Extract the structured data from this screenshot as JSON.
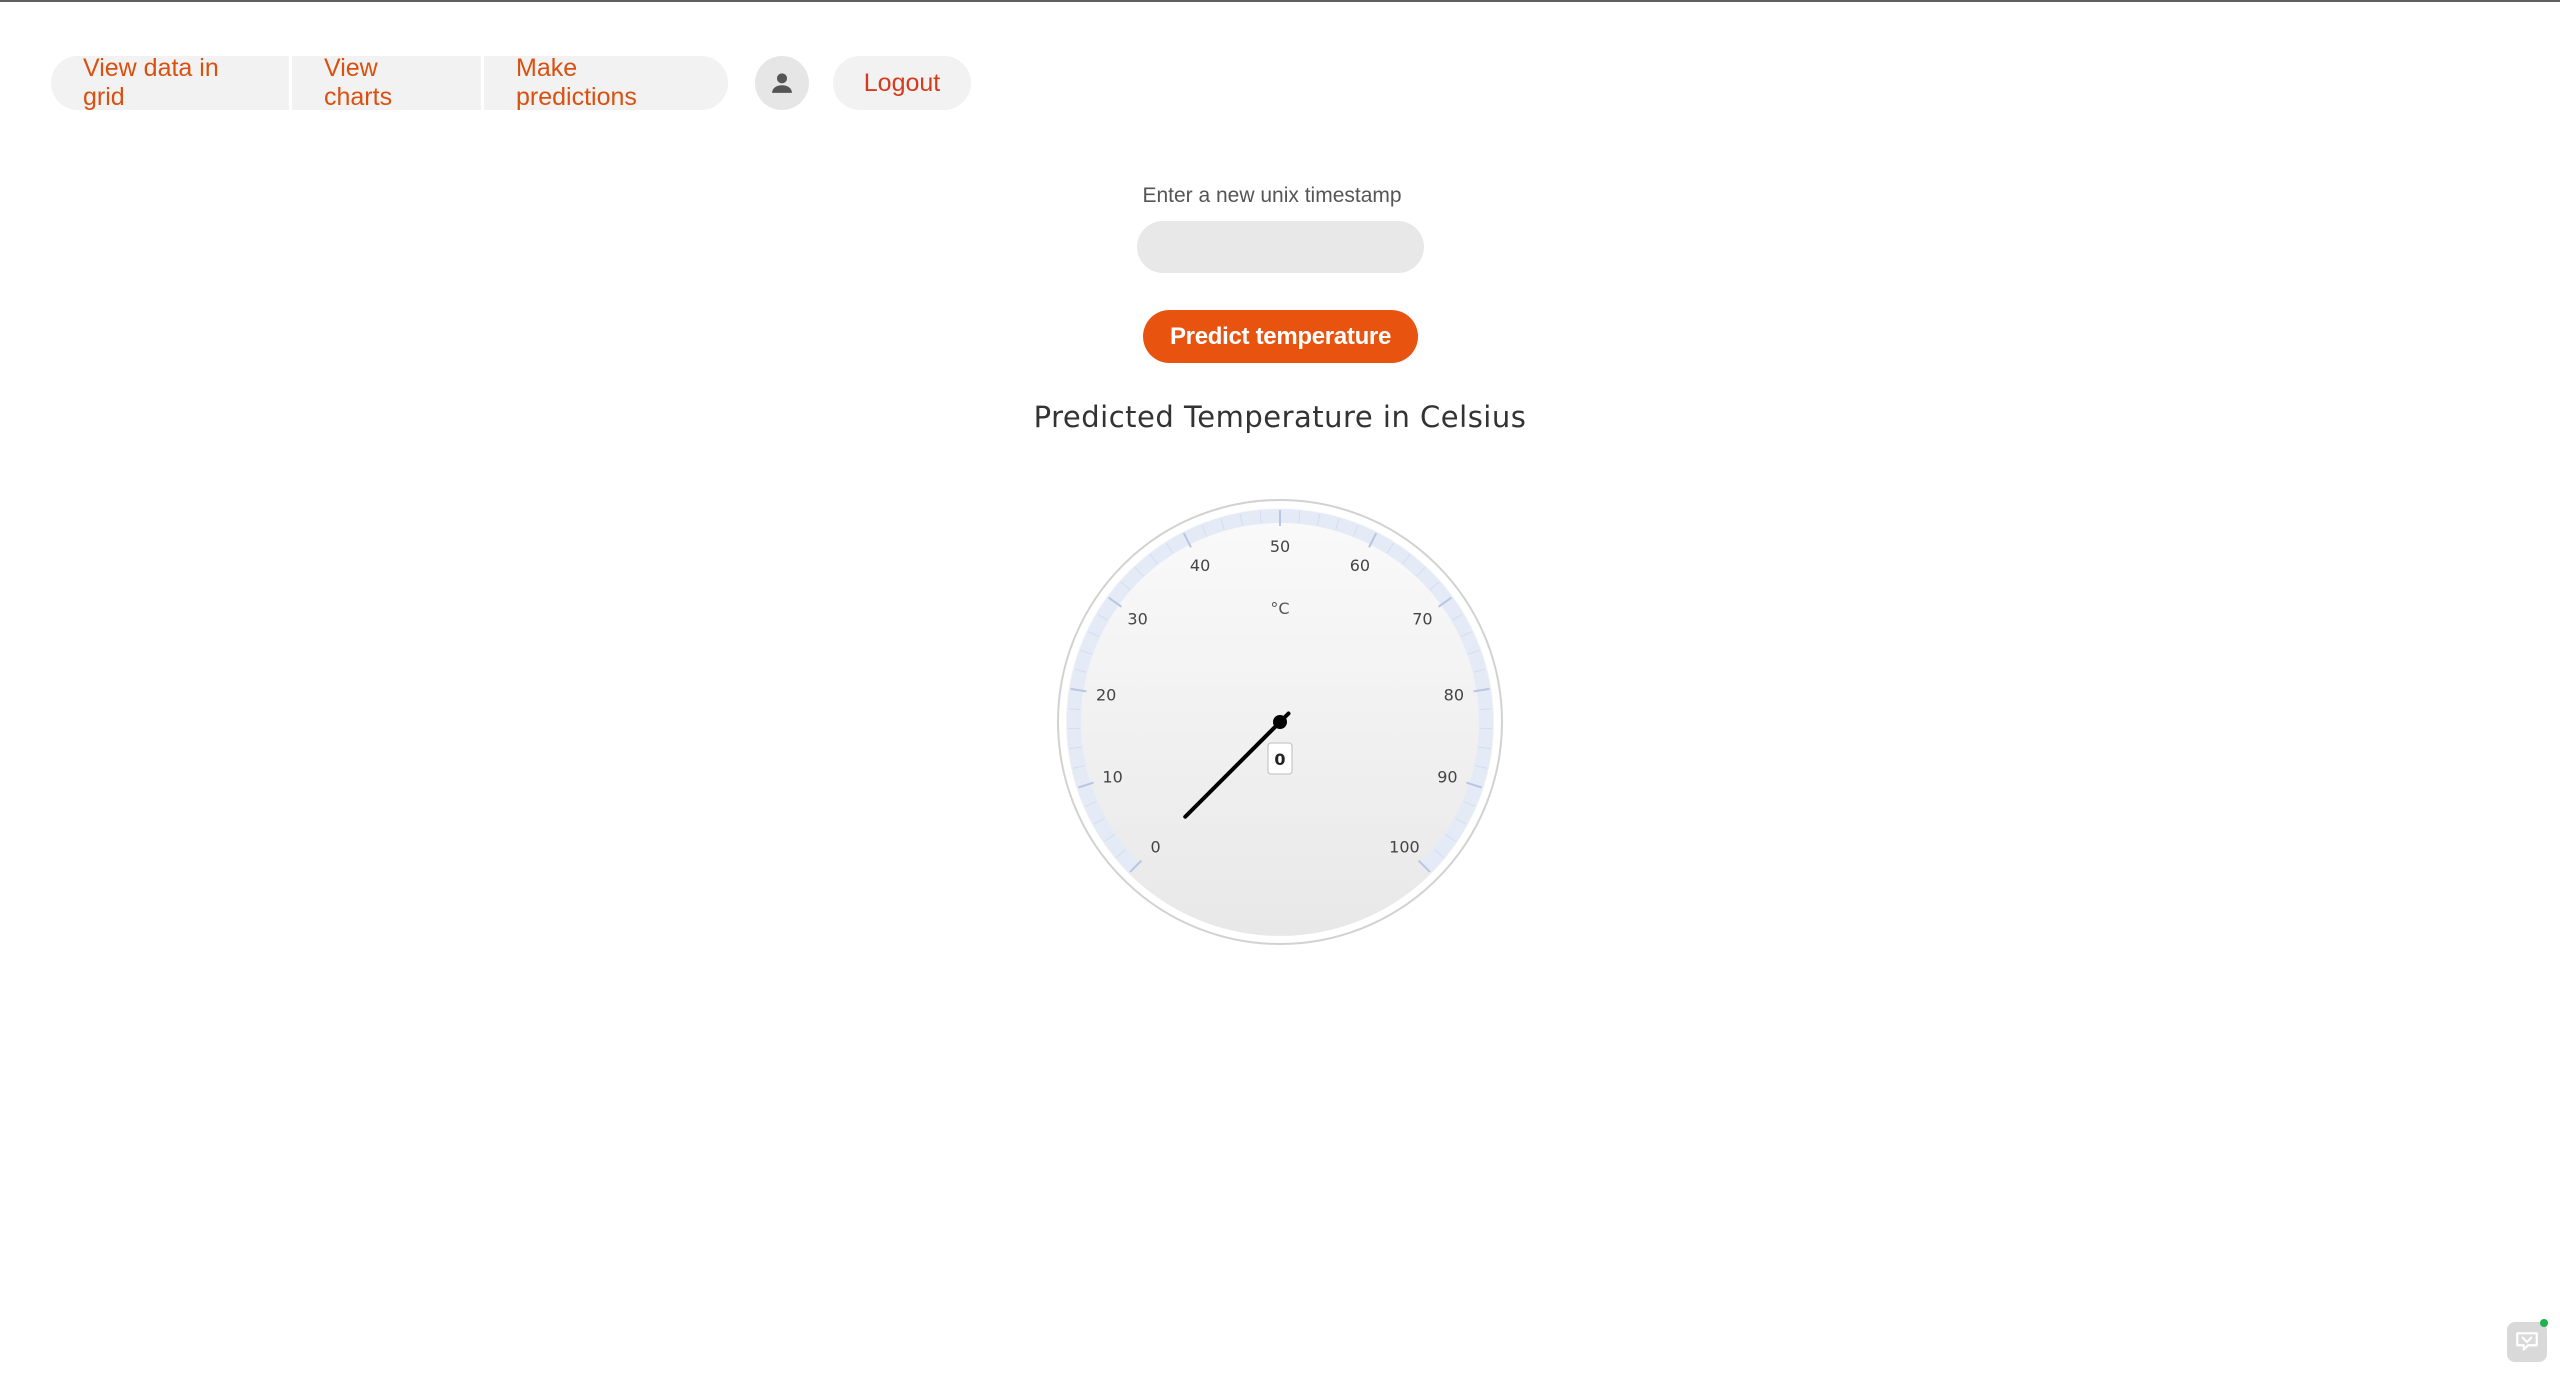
{
  "nav": {
    "view_grid_label": "View data in grid",
    "view_charts_label": "View charts",
    "make_predictions_label": "Make predictions",
    "avatar_icon": "user-icon",
    "logout_label": "Logout"
  },
  "form": {
    "timestamp_label": "Enter a new unix timestamp",
    "timestamp_value": "",
    "timestamp_placeholder": "",
    "predict_button_label": "Predict temperature"
  },
  "gauge": {
    "title": "Predicted Temperature in Celsius",
    "unit": "°C",
    "min": 0,
    "max": 100,
    "value": 0,
    "value_label": "0",
    "tick_labels": [
      "0",
      "10",
      "20",
      "30",
      "40",
      "50",
      "60",
      "70",
      "80",
      "90",
      "100"
    ],
    "colors": {
      "band": "#e4ebf7",
      "needle": "#000000",
      "face": "#f2f2f2"
    }
  },
  "colors": {
    "accent": "#e8540f",
    "nav_text": "#d9500f",
    "logout_text": "#d63a1c",
    "pill_bg": "#f2f2f2"
  },
  "widgets": {
    "chat_icon": "chat-widget-icon"
  }
}
